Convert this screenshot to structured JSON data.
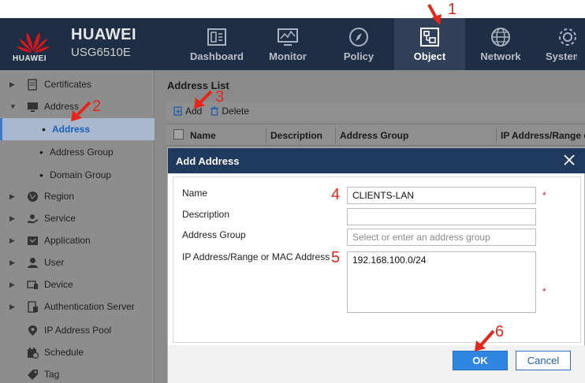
{
  "header": {
    "brand": "HUAWEI",
    "model": "USG6510E",
    "logo_text": "HUAWEI",
    "nav": [
      {
        "label": "Dashboard",
        "icon": "dashboard-icon",
        "active": false
      },
      {
        "label": "Monitor",
        "icon": "monitor-icon",
        "active": false
      },
      {
        "label": "Policy",
        "icon": "compass-icon",
        "active": false
      },
      {
        "label": "Object",
        "icon": "object-icon",
        "active": true
      },
      {
        "label": "Network",
        "icon": "globe-icon",
        "active": false
      },
      {
        "label": "System",
        "icon": "gear-icon",
        "active": false
      }
    ]
  },
  "sidebar": {
    "items": [
      {
        "label": "Certificates",
        "icon": "certificate-icon"
      },
      {
        "label": "Address",
        "icon": "address-icon"
      },
      {
        "label": "Address"
      },
      {
        "label": "Address Group"
      },
      {
        "label": "Domain Group"
      },
      {
        "label": "Region",
        "icon": "globe-icon"
      },
      {
        "label": "Service",
        "icon": "service-icon"
      },
      {
        "label": "Application",
        "icon": "application-icon"
      },
      {
        "label": "User",
        "icon": "user-icon"
      },
      {
        "label": "Device",
        "icon": "device-icon"
      },
      {
        "label": "Authentication Server",
        "icon": "server-icon"
      },
      {
        "label": "IP Address Pool",
        "icon": "location-icon"
      },
      {
        "label": "Schedule",
        "icon": "calendar-icon"
      },
      {
        "label": "Tag",
        "icon": "tag-icon"
      }
    ]
  },
  "main": {
    "list_title": "Address List",
    "toolbar": {
      "add_label": "Add",
      "delete_label": "Delete"
    },
    "columns": [
      "Name",
      "Description",
      "Address Group",
      "IP Address/Range or MAC Address"
    ]
  },
  "dialog": {
    "title": "Add Address",
    "fields": {
      "name": {
        "label": "Name",
        "value": "CLIENTS-LAN",
        "required": "*"
      },
      "description": {
        "label": "Description",
        "value": ""
      },
      "address_group": {
        "label": "Address Group",
        "placeholder": "Select or enter an address group"
      },
      "ip": {
        "label": "IP Address/Range or MAC Address",
        "value": "192.168.100.0/24",
        "required": "*"
      }
    },
    "ok_label": "OK",
    "cancel_label": "Cancel"
  },
  "annotations": [
    "1",
    "2",
    "3",
    "4",
    "5",
    "6"
  ],
  "colors": {
    "header_bg": "#1e2e44",
    "dialog_header": "#1f3a5c",
    "ok_button": "#2f86e0",
    "annotation": "#e4261b"
  }
}
